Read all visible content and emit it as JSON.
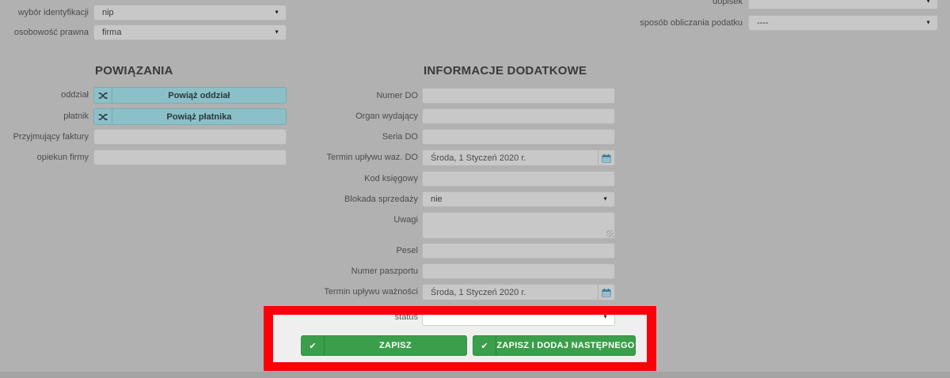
{
  "top_left": {
    "rows": [
      {
        "label": "wybór identyfikacji",
        "value": "nip"
      },
      {
        "label": "osobowość prawna",
        "value": "firma"
      }
    ]
  },
  "top_right": {
    "rows": [
      {
        "label": "dopisek",
        "value": ""
      },
      {
        "label": "sposób obliczania podatku",
        "value": "----"
      }
    ]
  },
  "powiazania": {
    "title": "POWIĄZANIA",
    "rows": [
      {
        "label": "oddział",
        "button": "Powiąż oddział"
      },
      {
        "label": "płatnik",
        "button": "Powiąż płatnika"
      },
      {
        "label": "Przyjmujący faktury",
        "value": ""
      },
      {
        "label": "opiekun firmy",
        "value": ""
      }
    ]
  },
  "informacje": {
    "title": "INFORMACJE DODATKOWE",
    "rows": [
      {
        "label": "Numer DO",
        "value": ""
      },
      {
        "label": "Organ wydający",
        "value": ""
      },
      {
        "label": "Seria DO",
        "value": ""
      },
      {
        "label": "Termin upływu waz. DO",
        "value": "Środa, 1 Styczeń 2020 r."
      },
      {
        "label": "Kod księgowy",
        "value": ""
      },
      {
        "label": "Blokada sprzedaży",
        "value": "nie"
      },
      {
        "label": "Uwagi",
        "value": ""
      },
      {
        "label": "Pesel",
        "value": ""
      },
      {
        "label": "Numer paszportu",
        "value": ""
      },
      {
        "label": "Termin upływu ważności",
        "value": "Środa, 1 Styczeń 2020 r."
      }
    ]
  },
  "status_row": {
    "label": "status",
    "value": ""
  },
  "buttons": {
    "save": "ZAPISZ",
    "save_and_next": "ZAPISZ I DODAJ NASTĘPNEGO"
  },
  "icons": {
    "dropdown_arrow": "▼",
    "check": "✔"
  },
  "colors": {
    "highlight_border": "#fb0006",
    "button_green": "#3b9e4a",
    "link_teal": "#8cc0c8",
    "overlay_gray": "#b1b1b1"
  }
}
